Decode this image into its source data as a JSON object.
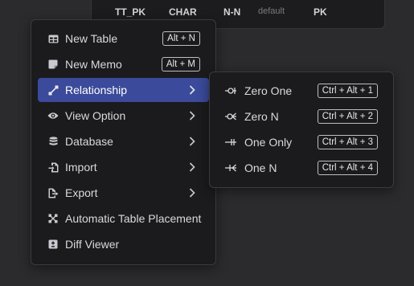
{
  "table": {
    "column_name": "TT_PK",
    "data_type": "CHAR",
    "nullable": "N-N",
    "default_placeholder": "default",
    "key": "PK"
  },
  "main_menu": {
    "items": [
      {
        "label": "New Table",
        "shortcut": "Alt + N",
        "icon": "table-icon"
      },
      {
        "label": "New Memo",
        "shortcut": "Alt + M",
        "icon": "memo-icon"
      },
      {
        "label": "Relationship",
        "icon": "relationship-icon",
        "submenu": true,
        "active": true
      },
      {
        "label": "View Option",
        "icon": "eye-icon",
        "submenu": true
      },
      {
        "label": "Database",
        "icon": "database-icon",
        "submenu": true
      },
      {
        "label": "Import",
        "icon": "import-icon",
        "submenu": true
      },
      {
        "label": "Export",
        "icon": "export-icon",
        "submenu": true
      },
      {
        "label": "Automatic Table Placement",
        "icon": "auto-placement-icon"
      },
      {
        "label": "Diff Viewer",
        "icon": "diff-icon"
      }
    ]
  },
  "relationship_menu": {
    "items": [
      {
        "label": "Zero One",
        "shortcut": "Ctrl + Alt + 1",
        "icon": "zero-one-icon"
      },
      {
        "label": "Zero N",
        "shortcut": "Ctrl + Alt + 2",
        "icon": "zero-n-icon"
      },
      {
        "label": "One Only",
        "shortcut": "Ctrl + Alt + 3",
        "icon": "one-only-icon"
      },
      {
        "label": "One N",
        "shortcut": "Ctrl + Alt + 4",
        "icon": "one-n-icon"
      }
    ]
  },
  "colors": {
    "menu_bg": "#1b1b1e",
    "active_item_bg": "#3b4a9a",
    "canvas_bg": "#2b2b2e"
  }
}
